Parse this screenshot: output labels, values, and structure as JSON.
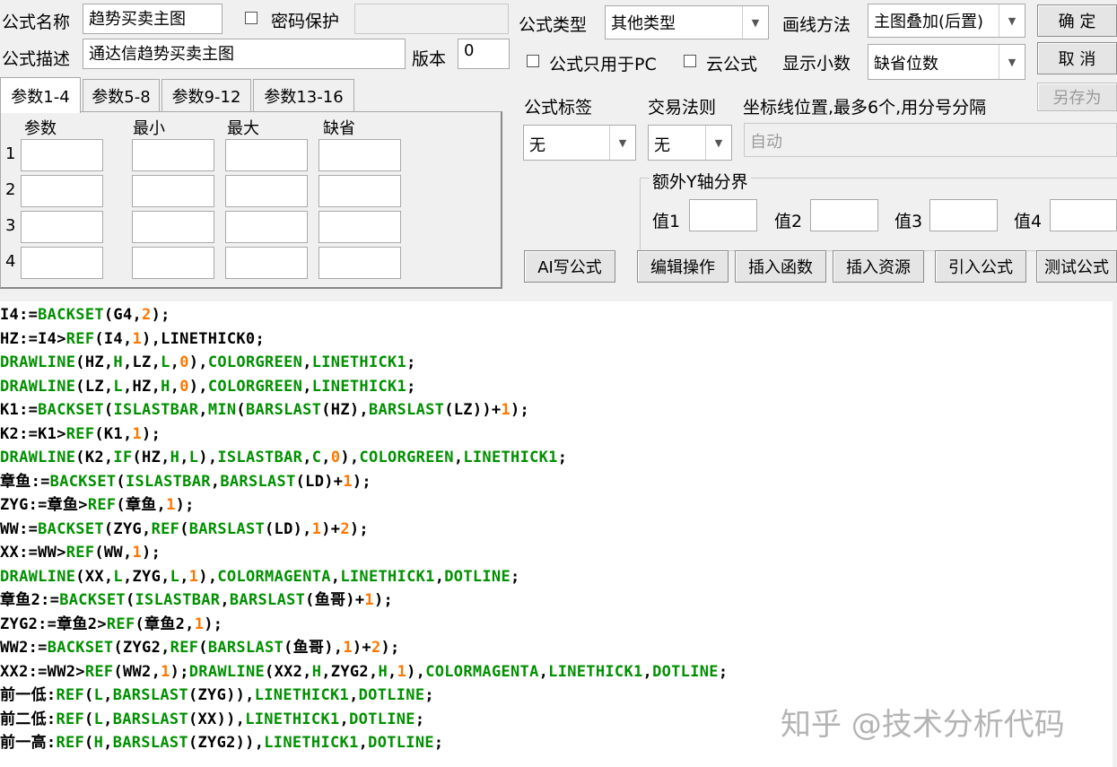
{
  "form": {
    "name_label": "公式名称",
    "name_value": "趋势买卖主图",
    "password_label": "密码保护",
    "desc_label": "公式描述",
    "desc_value": "通达信趋势买卖主图",
    "version_label": "版本",
    "version_value": "0",
    "type_label": "公式类型",
    "type_value": "其他类型",
    "draw_label": "画线方法",
    "draw_value": "主图叠加(后置)",
    "pc_only_label": "公式只用于PC",
    "cloud_label": "云公式",
    "decimals_label": "显示小数",
    "decimals_value": "缺省位数",
    "tag_label": "公式标签",
    "tag_value": "无",
    "trade_label": "交易法则",
    "trade_value": "无",
    "axis_label": "坐标线位置,最多6个,用分号分隔",
    "axis_placeholder": "自动",
    "extra_y_label": "额外Y轴分界",
    "v1": "值1",
    "v2": "值2",
    "v3": "值3",
    "v4": "值4"
  },
  "buttons": {
    "ok": "确 定",
    "cancel": "取 消",
    "save_as": "另存为",
    "ai": "AI写公式",
    "edit": "编辑操作",
    "insert_func": "插入函数",
    "insert_res": "插入资源",
    "import": "引入公式",
    "test": "测试公式"
  },
  "tabs": [
    "参数1-4",
    "参数5-8",
    "参数9-12",
    "参数13-16"
  ],
  "param_headers": [
    "参数",
    "最小",
    "最大",
    "缺省"
  ],
  "param_rows": [
    "1",
    "2",
    "3",
    "4"
  ],
  "code_lines": [
    [
      [
        "tx",
        "I4:="
      ],
      [
        "fn",
        "BACKSET"
      ],
      [
        "tx",
        "(G4,"
      ],
      [
        "num",
        "2"
      ],
      [
        "tx",
        ");"
      ]
    ],
    [
      [
        "tx",
        "HZ:=I4>"
      ],
      [
        "fn",
        "REF"
      ],
      [
        "tx",
        "(I4,"
      ],
      [
        "num",
        "1"
      ],
      [
        "tx",
        "),LINETHICK0;"
      ]
    ],
    [
      [
        "fn",
        "DRAWLINE"
      ],
      [
        "tx",
        "(HZ,"
      ],
      [
        "fn",
        "H"
      ],
      [
        "tx",
        ",LZ,"
      ],
      [
        "fn",
        "L"
      ],
      [
        "tx",
        ","
      ],
      [
        "num",
        "0"
      ],
      [
        "tx",
        "),"
      ],
      [
        "fn",
        "COLORGREEN"
      ],
      [
        "tx",
        ","
      ],
      [
        "fn",
        "LINETHICK1"
      ],
      [
        "tx",
        ";"
      ]
    ],
    [
      [
        "fn",
        "DRAWLINE"
      ],
      [
        "tx",
        "(LZ,"
      ],
      [
        "fn",
        "L"
      ],
      [
        "tx",
        ",HZ,"
      ],
      [
        "fn",
        "H"
      ],
      [
        "tx",
        ","
      ],
      [
        "num",
        "0"
      ],
      [
        "tx",
        "),"
      ],
      [
        "fn",
        "COLORGREEN"
      ],
      [
        "tx",
        ","
      ],
      [
        "fn",
        "LINETHICK1"
      ],
      [
        "tx",
        ";"
      ]
    ],
    [
      [
        "tx",
        "K1:="
      ],
      [
        "fn",
        "BACKSET"
      ],
      [
        "tx",
        "("
      ],
      [
        "fn",
        "ISLASTBAR"
      ],
      [
        "tx",
        ","
      ],
      [
        "fn",
        "MIN"
      ],
      [
        "tx",
        "("
      ],
      [
        "fn",
        "BARSLAST"
      ],
      [
        "tx",
        "(HZ),"
      ],
      [
        "fn",
        "BARSLAST"
      ],
      [
        "tx",
        "(LZ))+"
      ],
      [
        "num",
        "1"
      ],
      [
        "tx",
        ");"
      ]
    ],
    [
      [
        "tx",
        "K2:=K1>"
      ],
      [
        "fn",
        "REF"
      ],
      [
        "tx",
        "(K1,"
      ],
      [
        "num",
        "1"
      ],
      [
        "tx",
        ");"
      ]
    ],
    [
      [
        "fn",
        "DRAWLINE"
      ],
      [
        "tx",
        "(K2,"
      ],
      [
        "fn",
        "IF"
      ],
      [
        "tx",
        "(HZ,"
      ],
      [
        "fn",
        "H"
      ],
      [
        "tx",
        ","
      ],
      [
        "fn",
        "L"
      ],
      [
        "tx",
        "),"
      ],
      [
        "fn",
        "ISLASTBAR"
      ],
      [
        "tx",
        ","
      ],
      [
        "fn",
        "C"
      ],
      [
        "tx",
        ","
      ],
      [
        "num",
        "0"
      ],
      [
        "tx",
        "),"
      ],
      [
        "fn",
        "COLORGREEN"
      ],
      [
        "tx",
        ","
      ],
      [
        "fn",
        "LINETHICK1"
      ],
      [
        "tx",
        ";"
      ]
    ],
    [
      [
        "tx",
        "章鱼:="
      ],
      [
        "fn",
        "BACKSET"
      ],
      [
        "tx",
        "("
      ],
      [
        "fn",
        "ISLASTBAR"
      ],
      [
        "tx",
        ","
      ],
      [
        "fn",
        "BARSLAST"
      ],
      [
        "tx",
        "(LD)+"
      ],
      [
        "num",
        "1"
      ],
      [
        "tx",
        ");"
      ]
    ],
    [
      [
        "tx",
        "ZYG:=章鱼>"
      ],
      [
        "fn",
        "REF"
      ],
      [
        "tx",
        "(章鱼,"
      ],
      [
        "num",
        "1"
      ],
      [
        "tx",
        ");"
      ]
    ],
    [
      [
        "tx",
        "WW:="
      ],
      [
        "fn",
        "BACKSET"
      ],
      [
        "tx",
        "(ZYG,"
      ],
      [
        "fn",
        "REF"
      ],
      [
        "tx",
        "("
      ],
      [
        "fn",
        "BARSLAST"
      ],
      [
        "tx",
        "(LD),"
      ],
      [
        "num",
        "1"
      ],
      [
        "tx",
        ")+"
      ],
      [
        "num",
        "2"
      ],
      [
        "tx",
        ");"
      ]
    ],
    [
      [
        "tx",
        "XX:=WW>"
      ],
      [
        "fn",
        "REF"
      ],
      [
        "tx",
        "(WW,"
      ],
      [
        "num",
        "1"
      ],
      [
        "tx",
        ");"
      ]
    ],
    [
      [
        "fn",
        "DRAWLINE"
      ],
      [
        "tx",
        "(XX,"
      ],
      [
        "fn",
        "L"
      ],
      [
        "tx",
        ",ZYG,"
      ],
      [
        "fn",
        "L"
      ],
      [
        "tx",
        ","
      ],
      [
        "num",
        "1"
      ],
      [
        "tx",
        "),"
      ],
      [
        "fn",
        "COLORMAGENTA"
      ],
      [
        "tx",
        ","
      ],
      [
        "fn",
        "LINETHICK1"
      ],
      [
        "tx",
        ","
      ],
      [
        "fn",
        "DOTLINE"
      ],
      [
        "tx",
        ";"
      ]
    ],
    [
      [
        "tx",
        "章鱼2:="
      ],
      [
        "fn",
        "BACKSET"
      ],
      [
        "tx",
        "("
      ],
      [
        "fn",
        "ISLASTBAR"
      ],
      [
        "tx",
        ","
      ],
      [
        "fn",
        "BARSLAST"
      ],
      [
        "tx",
        "(鱼哥)+"
      ],
      [
        "num",
        "1"
      ],
      [
        "tx",
        ");"
      ]
    ],
    [
      [
        "tx",
        "ZYG2:=章鱼2>"
      ],
      [
        "fn",
        "REF"
      ],
      [
        "tx",
        "(章鱼2,"
      ],
      [
        "num",
        "1"
      ],
      [
        "tx",
        ");"
      ]
    ],
    [
      [
        "tx",
        "WW2:="
      ],
      [
        "fn",
        "BACKSET"
      ],
      [
        "tx",
        "(ZYG2,"
      ],
      [
        "fn",
        "REF"
      ],
      [
        "tx",
        "("
      ],
      [
        "fn",
        "BARSLAST"
      ],
      [
        "tx",
        "(鱼哥),"
      ],
      [
        "num",
        "1"
      ],
      [
        "tx",
        ")+"
      ],
      [
        "num",
        "2"
      ],
      [
        "tx",
        ");"
      ]
    ],
    [
      [
        "tx",
        "XX2:=WW2>"
      ],
      [
        "fn",
        "REF"
      ],
      [
        "tx",
        "(WW2,"
      ],
      [
        "num",
        "1"
      ],
      [
        "tx",
        ");"
      ],
      [
        "fn",
        "DRAWLINE"
      ],
      [
        "tx",
        "(XX2,"
      ],
      [
        "fn",
        "H"
      ],
      [
        "tx",
        ",ZYG2,"
      ],
      [
        "fn",
        "H"
      ],
      [
        "tx",
        ","
      ],
      [
        "num",
        "1"
      ],
      [
        "tx",
        "),"
      ],
      [
        "fn",
        "COLORMAGENTA"
      ],
      [
        "tx",
        ","
      ],
      [
        "fn",
        "LINETHICK1"
      ],
      [
        "tx",
        ","
      ],
      [
        "fn",
        "DOTLINE"
      ],
      [
        "tx",
        ";"
      ]
    ],
    [
      [
        "tx",
        "前一低:"
      ],
      [
        "fn",
        "REF"
      ],
      [
        "tx",
        "("
      ],
      [
        "fn",
        "L"
      ],
      [
        "tx",
        ","
      ],
      [
        "fn",
        "BARSLAST"
      ],
      [
        "tx",
        "(ZYG)),"
      ],
      [
        "fn",
        "LINETHICK1"
      ],
      [
        "tx",
        ","
      ],
      [
        "fn",
        "DOTLINE"
      ],
      [
        "tx",
        ";"
      ]
    ],
    [
      [
        "tx",
        "前二低:"
      ],
      [
        "fn",
        "REF"
      ],
      [
        "tx",
        "("
      ],
      [
        "fn",
        "L"
      ],
      [
        "tx",
        ","
      ],
      [
        "fn",
        "BARSLAST"
      ],
      [
        "tx",
        "(XX)),"
      ],
      [
        "fn",
        "LINETHICK1"
      ],
      [
        "tx",
        ","
      ],
      [
        "fn",
        "DOTLINE"
      ],
      [
        "tx",
        ";"
      ]
    ],
    [
      [
        "tx",
        "前一高:"
      ],
      [
        "fn",
        "REF"
      ],
      [
        "tx",
        "("
      ],
      [
        "fn",
        "H"
      ],
      [
        "tx",
        ","
      ],
      [
        "fn",
        "BARSLAST"
      ],
      [
        "tx",
        "(ZYG2)),"
      ],
      [
        "fn",
        "LINETHICK1"
      ],
      [
        "tx",
        ","
      ],
      [
        "fn",
        "DOTLINE"
      ],
      [
        "tx",
        ";"
      ]
    ]
  ],
  "watermark": "知乎 @技术分析代码",
  "colors": {
    "function": "#009000",
    "number": "#ff7700",
    "text": "#000000"
  }
}
